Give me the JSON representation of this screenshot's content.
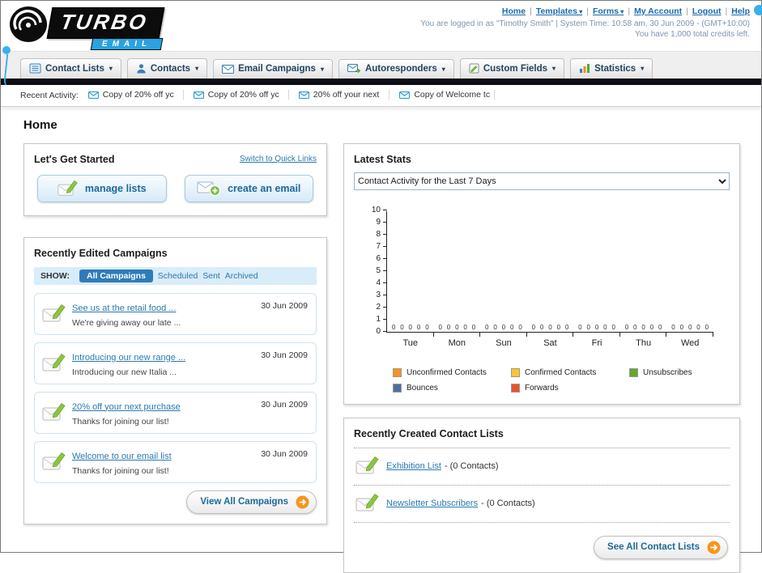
{
  "header": {
    "logo_main": "TURBO",
    "logo_sub": "EMAIL",
    "nav_links": [
      {
        "label": "Home",
        "dropdown": false
      },
      {
        "label": "Templates",
        "dropdown": true
      },
      {
        "label": "Forms",
        "dropdown": true
      },
      {
        "label": "My Account",
        "dropdown": false
      },
      {
        "label": "Logout",
        "dropdown": false
      },
      {
        "label": "Help",
        "dropdown": false
      }
    ],
    "login_info": "You are logged in as \"Timothy Smith\" | System Time: 10:58 am, 30 Jun 2009 - (GMT+10:00)",
    "credits_info": "You have 1,000 total credits left."
  },
  "nav_tabs": [
    {
      "label": "Contact Lists",
      "icon": "contact-lists-icon"
    },
    {
      "label": "Contacts",
      "icon": "contacts-icon"
    },
    {
      "label": "Email Campaigns",
      "icon": "email-campaigns-icon"
    },
    {
      "label": "Autoresponders",
      "icon": "autoresponders-icon"
    },
    {
      "label": "Custom Fields",
      "icon": "custom-fields-icon"
    },
    {
      "label": "Statistics",
      "icon": "statistics-icon"
    }
  ],
  "recent_activity": {
    "label": "Recent Activity:",
    "items": [
      "Copy of 20% off yc",
      "Copy of 20% off yc",
      "20% off your next",
      "Copy of Welcome tc"
    ]
  },
  "page_title": "Home",
  "get_started": {
    "title": "Let's Get Started",
    "switch_link": "Switch to Quick Links",
    "buttons": {
      "manage": "manage lists",
      "create": "create an email"
    }
  },
  "campaigns": {
    "title": "Recently Edited Campaigns",
    "show_label": "SHOW:",
    "filters": [
      {
        "label": "All Campaigns",
        "selected": true
      },
      {
        "label": "Scheduled",
        "selected": false
      },
      {
        "label": "Sent",
        "selected": false
      },
      {
        "label": "Archived",
        "selected": false
      }
    ],
    "items": [
      {
        "title": "See us at the retail food ...",
        "subtitle": "We're giving away our late ...",
        "date": "30 Jun 2009"
      },
      {
        "title": "Introducing our new range ...",
        "subtitle": "Introducing our new Italia ...",
        "date": "30 Jun 2009"
      },
      {
        "title": "20% off your next purchase",
        "subtitle": "Thanks for joining our list!",
        "date": "30 Jun 2009"
      },
      {
        "title": "Welcome to our email list",
        "subtitle": "Thanks for joining our list!",
        "date": "30 Jun 2009"
      }
    ],
    "view_all_label": "View All Campaigns"
  },
  "stats": {
    "title": "Latest Stats",
    "dropdown_value": "Contact Activity for the Last 7 Days",
    "chart_data": {
      "type": "bar",
      "title": "Contact Activity for the Last 7 Days",
      "categories": [
        "Tue",
        "Mon",
        "Sun",
        "Sat",
        "Fri",
        "Thu",
        "Wed"
      ],
      "series": [
        {
          "name": "Unconfirmed Contacts",
          "color": "#f7941d",
          "values": [
            0,
            0,
            0,
            0,
            0,
            0,
            0
          ]
        },
        {
          "name": "Confirmed Contacts",
          "color": "#fdc52e",
          "values": [
            0,
            0,
            0,
            0,
            0,
            0,
            0
          ]
        },
        {
          "name": "Unsubscribes",
          "color": "#61a832",
          "values": [
            0,
            0,
            0,
            0,
            0,
            0,
            0
          ]
        },
        {
          "name": "Bounces",
          "color": "#4d6fa0",
          "values": [
            0,
            0,
            0,
            0,
            0,
            0,
            0
          ]
        },
        {
          "name": "Forwards",
          "color": "#e8542a",
          "values": [
            0,
            0,
            0,
            0,
            0,
            0,
            0
          ]
        }
      ],
      "xlabel": "",
      "ylabel": "",
      "ylim": [
        0,
        10
      ],
      "yticks": [
        0,
        1,
        2,
        3,
        4,
        5,
        6,
        7,
        8,
        9,
        10
      ],
      "grid": false,
      "legend_position": "bottom"
    }
  },
  "contact_lists": {
    "title": "Recently Created Contact Lists",
    "items": [
      {
        "name": "Exhibition List",
        "suffix": "- (0 Contacts)"
      },
      {
        "name": "Newsletter Subscribers",
        "suffix": "- (0 Contacts)"
      }
    ],
    "see_all_label": "See All Contact Lists"
  }
}
